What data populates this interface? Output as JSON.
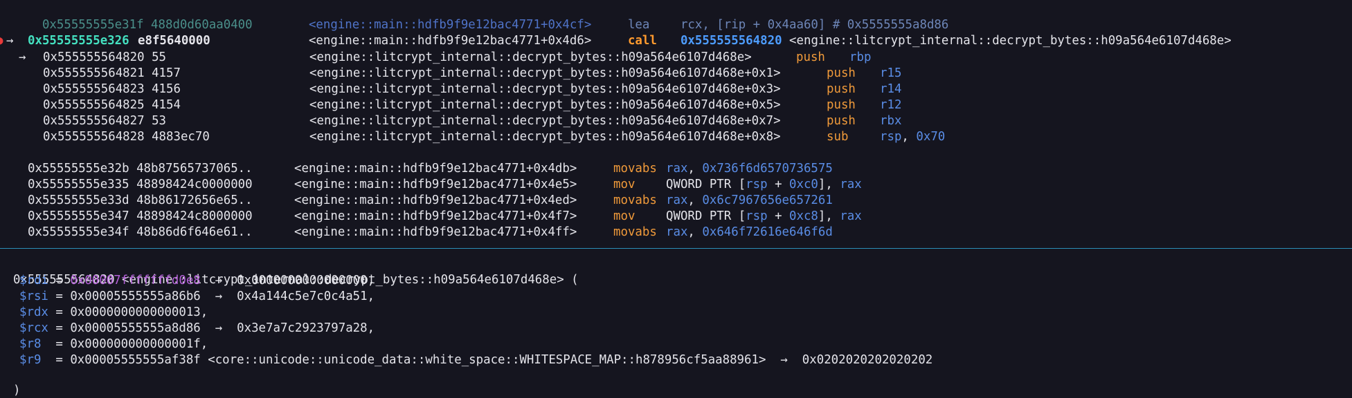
{
  "disasm_top": [
    {
      "addr": "0x55555555e31f",
      "bytes": "488d0d60aa0400",
      "sym": "<engine::main::hdfb9f9e12bac4771+0x4cf>",
      "mnem": "lea",
      "op_a": "rcx, [rip + 0x4aa60]",
      "op_b": "# 0x5555555a8d86"
    },
    {
      "marker": "●",
      "arrow": "→",
      "addr": "0x55555555e326",
      "bytes": "e8f5640000",
      "sym": "<engine::main::hdfb9f9e12bac4771+0x4d6>",
      "mnem": "call",
      "op_target": "0x555555564820",
      "op_sym": "<engine::litcrypt_internal::decrypt_bytes::h09a564e6107d468e>"
    }
  ],
  "call_target_lines": [
    {
      "arrow": "→",
      "addr": "0x555555564820",
      "bytes": "55",
      "sym": "<engine::litcrypt_internal::decrypt_bytes::h09a564e6107d468e>",
      "mnem": "push",
      "op": "rbp"
    },
    {
      "addr": "0x555555564821",
      "bytes": "4157",
      "sym": "<engine::litcrypt_internal::decrypt_bytes::h09a564e6107d468e+0x1>",
      "mnem": "push",
      "op": "r15"
    },
    {
      "addr": "0x555555564823",
      "bytes": "4156",
      "sym": "<engine::litcrypt_internal::decrypt_bytes::h09a564e6107d468e+0x3>",
      "mnem": "push",
      "op": "r14"
    },
    {
      "addr": "0x555555564825",
      "bytes": "4154",
      "sym": "<engine::litcrypt_internal::decrypt_bytes::h09a564e6107d468e+0x5>",
      "mnem": "push",
      "op": "r12"
    },
    {
      "addr": "0x555555564827",
      "bytes": "53",
      "sym": "<engine::litcrypt_internal::decrypt_bytes::h09a564e6107d468e+0x7>",
      "mnem": "push",
      "op": "rbx"
    },
    {
      "addr": "0x555555564828",
      "bytes": "4883ec70",
      "sym": "<engine::litcrypt_internal::decrypt_bytes::h09a564e6107d468e+0x8>",
      "mnem": "sub",
      "op_reg": "rsp",
      "op_sep": ", ",
      "op_imm": "0x70"
    }
  ],
  "disasm_bottom": [
    {
      "addr": "0x55555555e32b",
      "bytes": "48b87565737065..",
      "sym": "<engine::main::hdfb9f9e12bac4771+0x4db>",
      "mnem": "movabs",
      "op_reg": "rax",
      "op_sep": ", ",
      "op_imm": "0x736f6d6570736575"
    },
    {
      "addr": "0x55555555e335",
      "bytes": "48898424c0000000",
      "sym": "<engine::main::hdfb9f9e12bac4771+0x4e5>",
      "mnem": "mov",
      "op_pre": "QWORD PTR [",
      "op_r1": "rsp",
      "op_mid": " + ",
      "op_i1": "0xc0",
      "op_end": "], ",
      "op_r2": "rax"
    },
    {
      "addr": "0x55555555e33d",
      "bytes": "48b86172656e65..",
      "sym": "<engine::main::hdfb9f9e12bac4771+0x4ed>",
      "mnem": "movabs",
      "op_reg": "rax",
      "op_sep": ", ",
      "op_imm": "0x6c7967656e657261"
    },
    {
      "addr": "0x55555555e347",
      "bytes": "48898424c8000000",
      "sym": "<engine::main::hdfb9f9e12bac4771+0x4f7>",
      "mnem": "mov",
      "op_pre": "QWORD PTR [",
      "op_r1": "rsp",
      "op_mid": " + ",
      "op_i1": "0xc8",
      "op_end": "], ",
      "op_r2": "rax"
    },
    {
      "addr": "0x55555555e34f",
      "bytes": "48b86d6f646e61..",
      "sym": "<engine::main::hdfb9f9e12bac4771+0x4ff>",
      "mnem": "movabs",
      "op_reg": "rax",
      "op_sep": ", ",
      "op_imm": "0x646f72616e646f6d"
    }
  ],
  "args": {
    "header": "0×555555564820 <engine::litcrypt_internal::decrypt_bytes::h09a564e6107d468e> (",
    "close": ")",
    "regs": [
      {
        "name": "$rdi",
        "eq": " = ",
        "val": "0x00007fffffffd0e8",
        "arrow": "  →  ",
        "deref": "0x0000000000000000,"
      },
      {
        "name": "$rsi",
        "eq": " = ",
        "val": "0x00005555555a86b6",
        "arrow": "  →  ",
        "deref": "0x4a144c5e7c0c4a51,"
      },
      {
        "name": "$rdx",
        "eq": " = ",
        "val": "0x0000000000000013,"
      },
      {
        "name": "$rcx",
        "eq": " = ",
        "val": "0x00005555555a8d86",
        "arrow": "  →  ",
        "deref": "0x3e7a7c2923797a28,"
      },
      {
        "name": "$r8",
        "eq": "  = ",
        "val": "0x000000000000001f,"
      },
      {
        "name": "$r9",
        "eq": "  = ",
        "val": "0x00005555555af38f <core::unicode::unicode_data::white_space::WHITESPACE_MAP::h878956cf5aa88961>",
        "arrow": "  →  ",
        "deref": "0x0202020202020202"
      }
    ]
  },
  "colors": {
    "background": "#15151f",
    "mnemonic": "#f09a3a",
    "operand": "#5a8de6",
    "current_address": "#44e0c0",
    "divider": "#2b8fb8",
    "rdi_value": "#b25fd6"
  }
}
